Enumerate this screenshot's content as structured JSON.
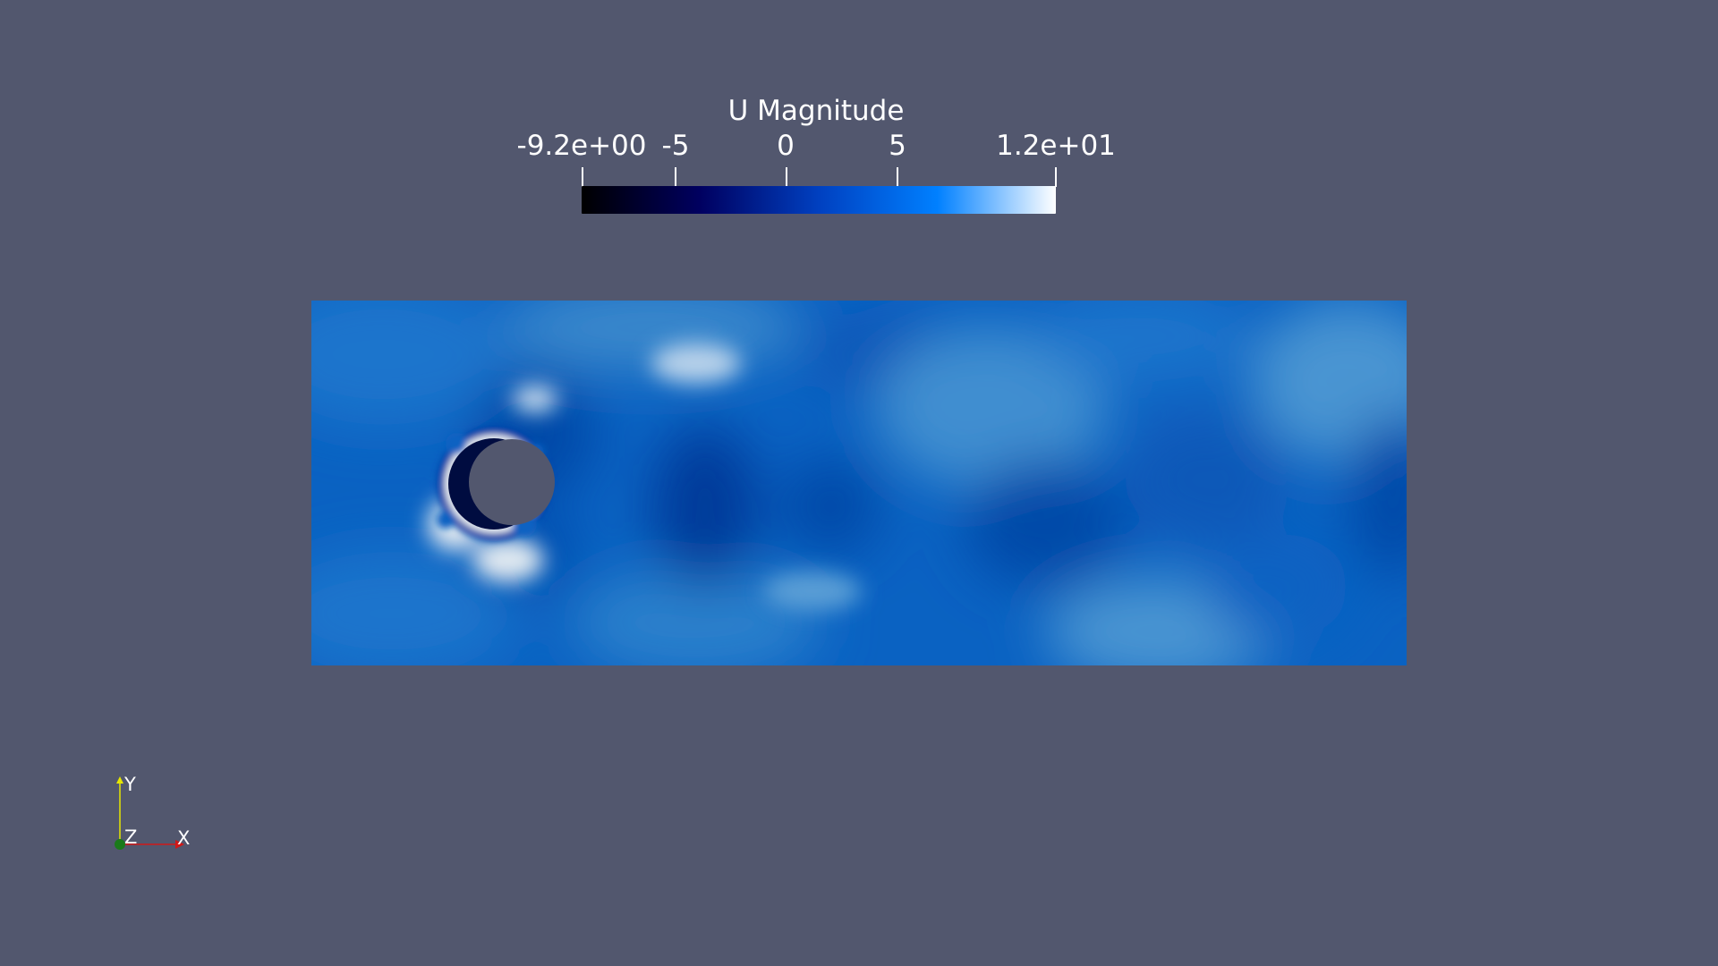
{
  "colorbar": {
    "title": "U Magnitude",
    "min_label": "-9.2e+00",
    "max_label": "1.2e+01",
    "range": [
      -9.2,
      12
    ],
    "ticks": [
      {
        "value": -9.2,
        "label": "-9.2e+00"
      },
      {
        "value": -5,
        "label": "-5"
      },
      {
        "value": 0,
        "label": "0"
      },
      {
        "value": 5,
        "label": "5"
      },
      {
        "value": 12,
        "label": "1.2e+01"
      }
    ],
    "colormap": [
      "#000000",
      "#000060",
      "#0040c0",
      "#0080ff",
      "#ffffff"
    ]
  },
  "colors": {
    "background": "#52576e",
    "field_base": "#0a62c2",
    "axis_x": "#d01818",
    "axis_y": "#e6e600",
    "axis_z": "#1a7a1a"
  },
  "axes": {
    "x_label": "X",
    "y_label": "Y",
    "z_label": "Z"
  }
}
